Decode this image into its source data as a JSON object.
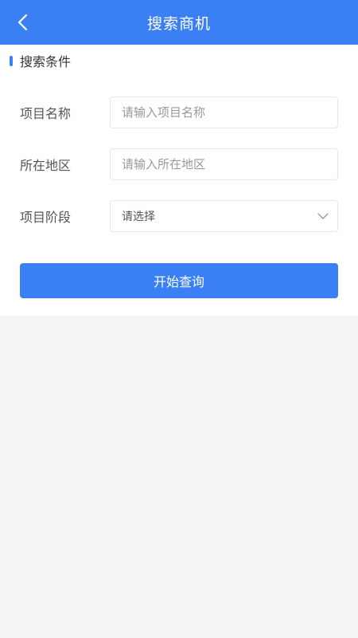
{
  "header": {
    "title": "搜索商机",
    "back_icon": "chevron-left-icon",
    "background": "#3b7ff5"
  },
  "section": {
    "title": "搜索条件"
  },
  "form": {
    "fields": [
      {
        "label": "项目名称",
        "placeholder": "请输入项目名称",
        "value": ""
      },
      {
        "label": "所在地区",
        "placeholder": "请输入所在地区",
        "value": ""
      },
      {
        "label": "项目阶段",
        "selected": "请选择",
        "icon": "chevron-down-icon"
      }
    ],
    "submit_label": "开始查询"
  }
}
